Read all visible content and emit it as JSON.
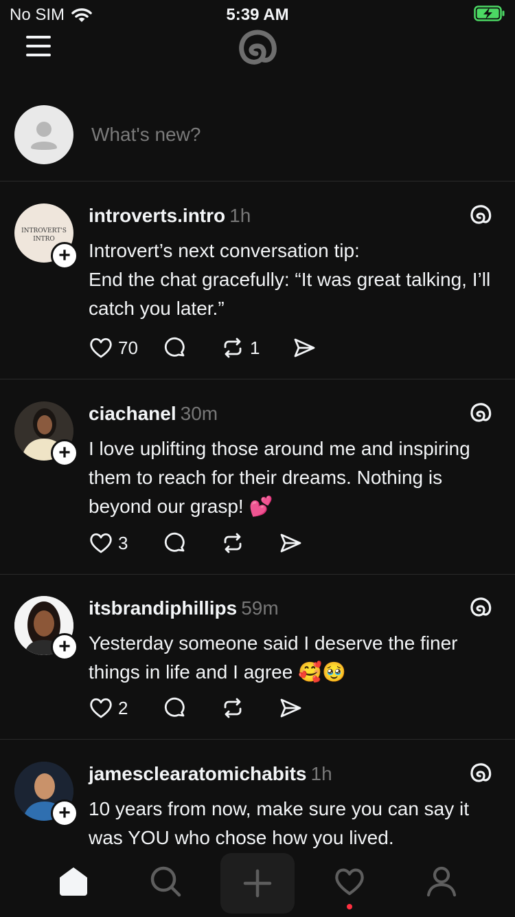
{
  "status_bar": {
    "carrier": "No SIM",
    "time": "5:39 AM"
  },
  "composer": {
    "placeholder": "What's new?"
  },
  "posts": [
    {
      "username": "introverts.intro",
      "time": "1h",
      "avatar_text": [
        "INTROVERT'S",
        "INTRO"
      ],
      "lines": [
        "Introvert’s next conversation tip:",
        "End the chat gracefully: “It was great talking, I’ll catch you later.”"
      ],
      "likes": "70",
      "replies": "",
      "reposts": "1"
    },
    {
      "username": "ciachanel",
      "time": "30m",
      "lines": [
        "I love uplifting those around me and inspiring them to reach for their dreams. Nothing is beyond our grasp! 💕"
      ],
      "likes": "3",
      "replies": "",
      "reposts": ""
    },
    {
      "username": "itsbrandiphillips",
      "time": "59m",
      "lines": [
        "Yesterday someone said I deserve the finer things in life and I agree 🥰🥹"
      ],
      "likes": "2",
      "replies": "",
      "reposts": ""
    },
    {
      "username": "jamesclearatomichabits",
      "time": "1h",
      "lines": [
        "10 years from now, make sure you can say it was YOU who chose how you lived."
      ],
      "likes": "",
      "replies": "",
      "reposts": ""
    }
  ],
  "tab_bar": {
    "items": [
      "home-icon",
      "search-icon",
      "plus-icon",
      "heart-icon",
      "profile-icon"
    ],
    "active": "home-icon"
  },
  "colors": {
    "background": "#101010",
    "text": "#f3f5f7",
    "muted": "#777777",
    "notification_dot": "#ff3040",
    "battery_green": "#4cd964"
  }
}
